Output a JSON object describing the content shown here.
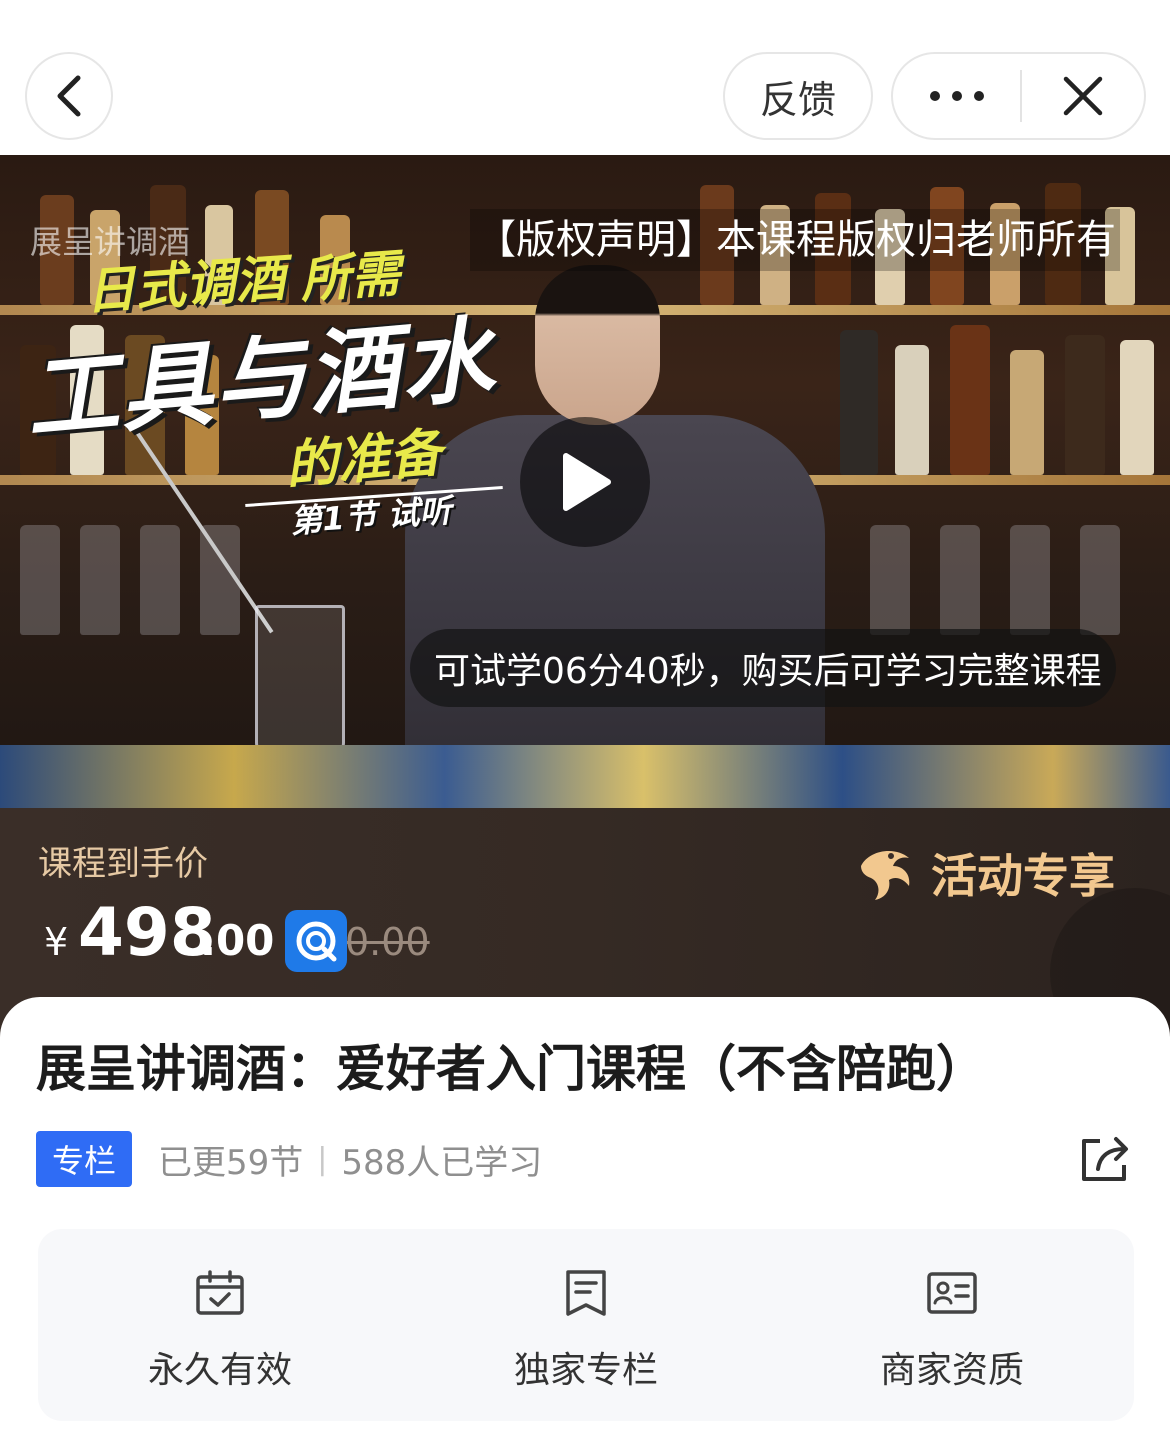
{
  "nav": {
    "feedback_label": "反馈",
    "back_icon": "chevron-left-icon",
    "more_icon": "more-dots-icon",
    "close_icon": "close-icon"
  },
  "video": {
    "watermark": "展呈讲调酒",
    "copyright_text": "【版权声明】本课程版权归老师所有",
    "overlay_line1a": "日式调酒",
    "overlay_line1b": "所需",
    "overlay_line2": "工具与酒水",
    "overlay_line3": "的准备",
    "overlay_line4": "第1节 试听",
    "trial_text": "可试学06分40秒，购买后可学习完整课程",
    "play_icon": "play-icon"
  },
  "price": {
    "label": "课程到手价",
    "currency": "¥",
    "integer": "498",
    "decimal": ".00",
    "original": "0.00",
    "activity_label": "活动专享",
    "accent_color": "#f2c88f"
  },
  "course": {
    "title": "展呈讲调酒：爱好者入门课程（不含陪跑）",
    "badge": "专栏",
    "updated": "已更59节",
    "learners": "588人已学习",
    "badge_color": "#2f6cf5"
  },
  "features": [
    {
      "label": "永久有效",
      "icon": "calendar-check-icon"
    },
    {
      "label": "独家专栏",
      "icon": "bookmark-doc-icon"
    },
    {
      "label": "商家资质",
      "icon": "id-card-icon"
    }
  ]
}
